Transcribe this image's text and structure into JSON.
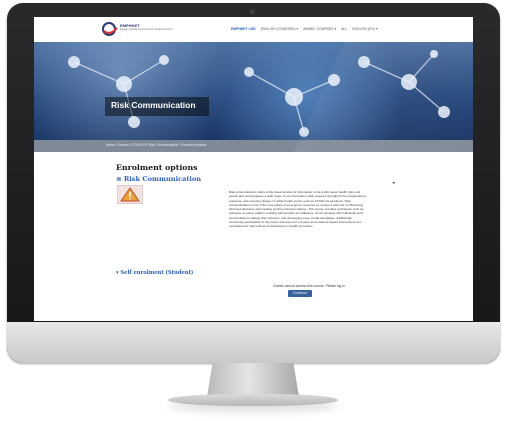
{
  "topbar": {
    "logo_text": "EMPHNET",
    "logo_subtitle": "Eastern Mediterranean Public Health Network",
    "nav": [
      "EMPHNET LMS",
      "ENGLISH (COURSES) ▾",
      "ARABIC COURSES ▾",
      "ALL",
      "ENGLISH (EN) ▾"
    ]
  },
  "hero": {
    "title": "Risk Communication"
  },
  "breadcrumb": {
    "text": "Home / Courses / COVID-19 / Risk Communication / Enrolment options"
  },
  "main": {
    "heading": "Enrolment options",
    "course_link": "≡ Risk Communication",
    "collapse_icon": "◂",
    "summary": "Risk communication refers to the dissemination of information to the public about health risks and events and encompasses a wide range of communication skills required throughout the preparedness, response, and recovery phases of public health events such as COVID-19 pandemic. Risk communication is one of the core pillars of emergency response as it plays a vital role in influencing informed decisions and creating positive behavior change. This course provides techniques such as: advocacy to policy makers, building partnerships and alliances, communicating with individuals and communities to change their behavior, and developing mass media campaigns. Additionally, community participation in the power and expert of a people and evidence-based interventions are considered as main ethical considerations in health promotion.",
    "enrol_link": "▾ Self enrolment (Student)",
    "guest_text": "Guests cannot access this course. Please log in.",
    "continue_button": "Continue"
  },
  "colors": {
    "link_blue": "#2a5ebb",
    "breadcrumb_bg": "#7f8998",
    "button_blue": "#2d5b9a",
    "hero_blue": "#27497d"
  }
}
